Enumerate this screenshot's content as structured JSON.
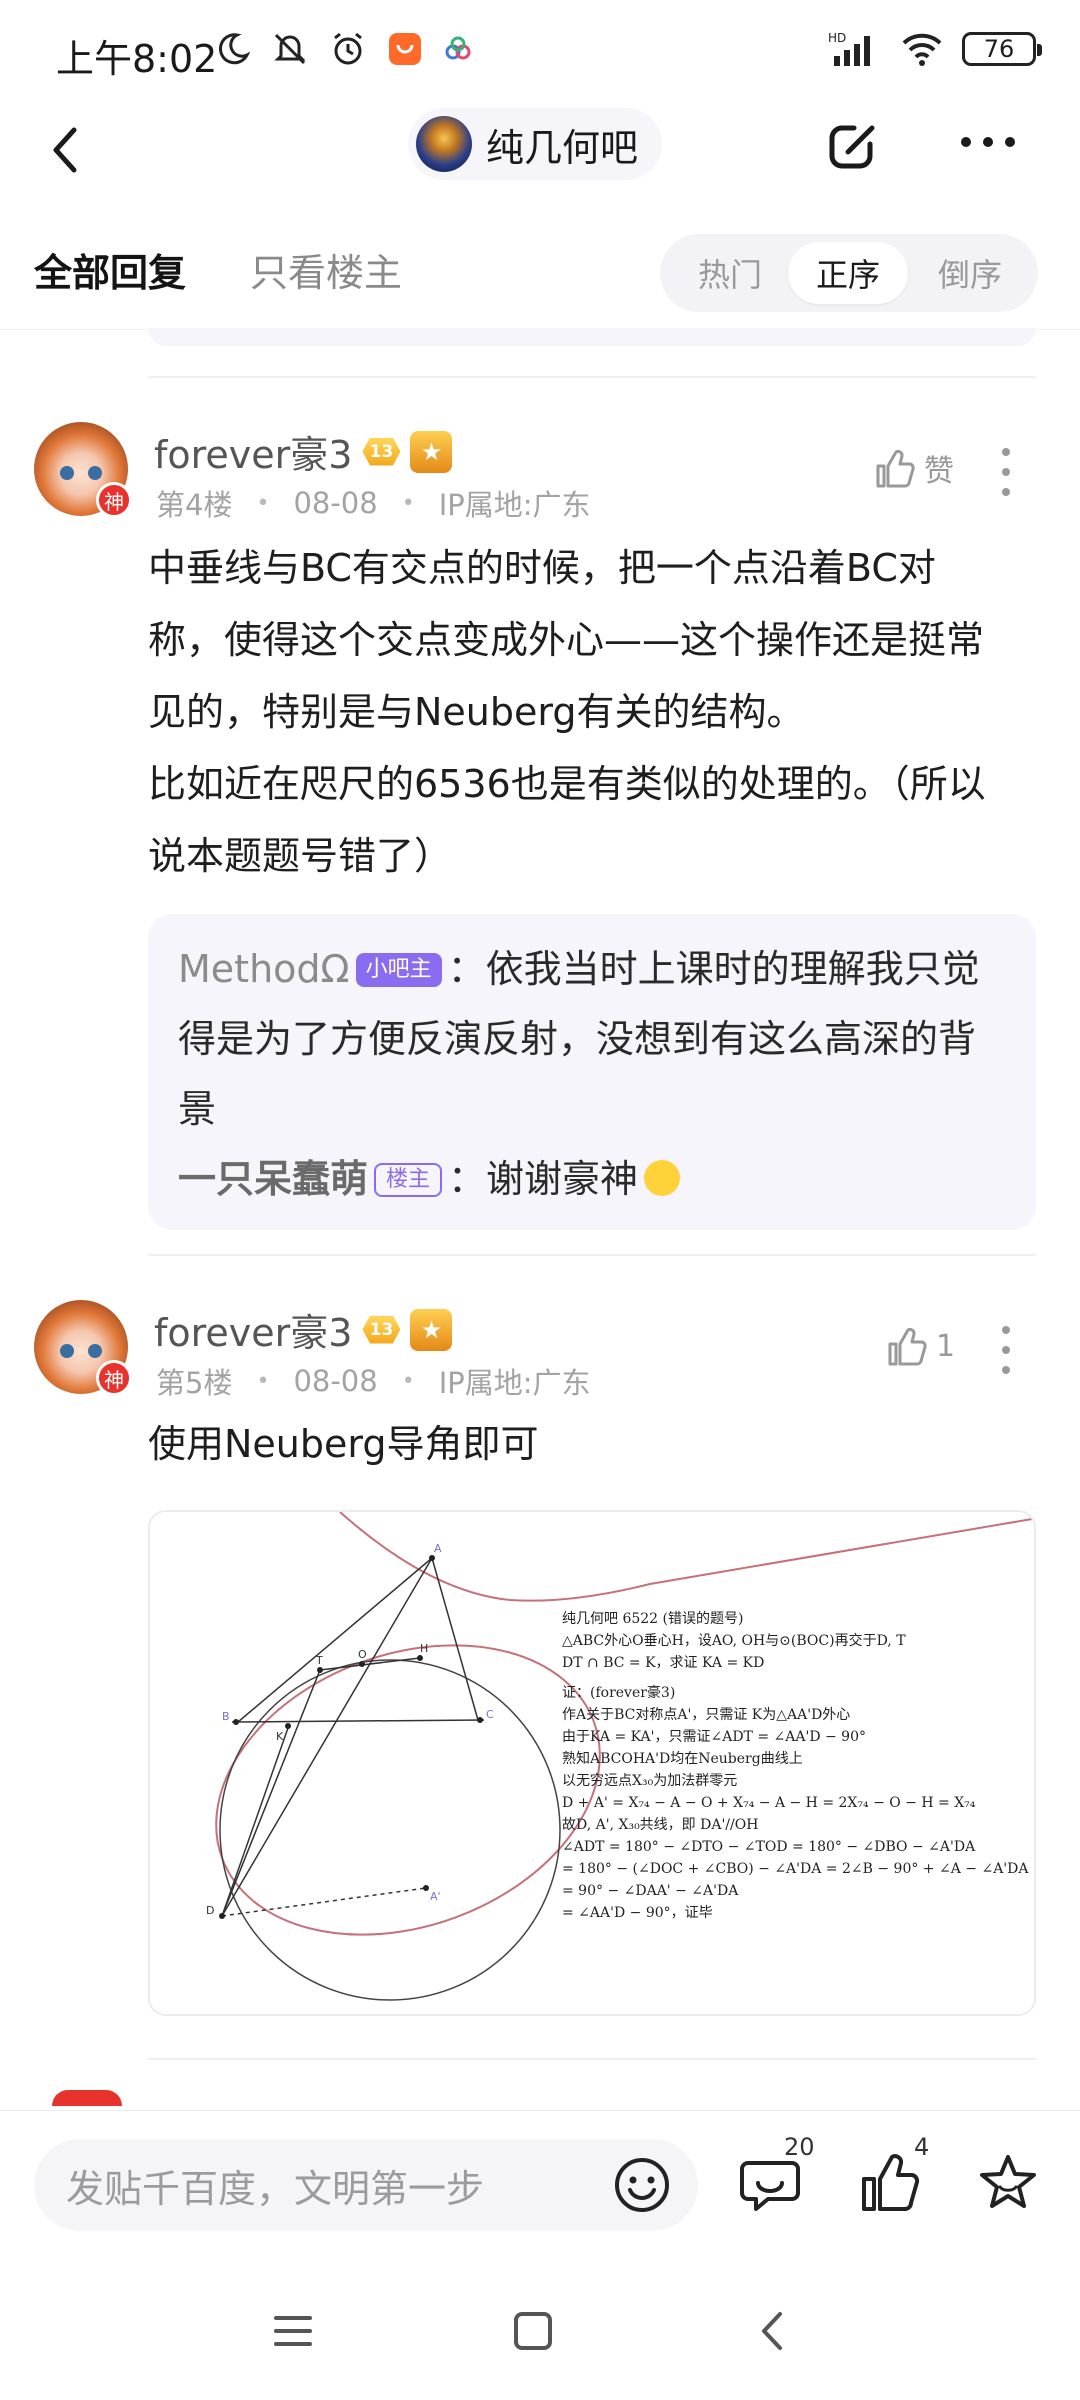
{
  "status_bar": {
    "time": "上午8:02",
    "network": "HD",
    "battery": "76"
  },
  "header": {
    "forum_name": "纯几何吧"
  },
  "tabs": {
    "all_replies": "全部回复",
    "owner_only": "只看楼主",
    "sort_options": [
      "热门",
      "正序",
      "倒序"
    ],
    "active_sort": "正序"
  },
  "posts": [
    {
      "username": "forever豪3",
      "level": "13",
      "god_badge": "神",
      "floor": "第4楼",
      "date": "08-08",
      "ip": "IP属地:广东",
      "like_label": "赞",
      "body": [
        "中垂线与BC有交点的时候，把一个点沿着BC对",
        "称，使得这个交点变成外心——这个操作还是挺常",
        "见的，特别是与Neuberg有关的结构。",
        "比如近在咫尺的6536也是有类似的处理的。（所以",
        "说本题题号错了）"
      ],
      "replies": [
        {
          "user": "MethodΩ",
          "tag": "小吧主",
          "lines": [
            "：依我当时上课时的理解我只觉",
            "得是为了方便反演反射，没想到有这么高深的背",
            "景"
          ]
        },
        {
          "user": "一只呆蠢萌",
          "tag": "楼主",
          "lines": [
            "：谢谢豪神"
          ]
        }
      ]
    },
    {
      "username": "forever豪3",
      "level": "13",
      "god_badge": "神",
      "floor": "第5楼",
      "date": "08-08",
      "ip": "IP属地:广东",
      "like_count": "1",
      "body": [
        "使用Neuberg导角即可"
      ],
      "figure": {
        "point_labels": [
          "A",
          "B",
          "C",
          "D",
          "K",
          "T",
          "O",
          "H",
          "A'"
        ],
        "text_lines": [
          "纯几何吧 6522 (错误的题号)",
          "△ABC外心O垂心H，设AO, OH与⊙(BOC)再交于D, T",
          "DT ∩ BC = K，求证 KA = KD",
          "",
          "证：(forever豪3)",
          "作A关于BC对称点A'，只需证 K为△AA'D外心",
          "由于KA = KA'，只需证∠ADT = ∠AA'D − 90°",
          "熟知ABCOHA'D均在Neuberg曲线上",
          "以无穷远点X₃₀为加法群零元",
          "D + A' = X₇₄ − A − O + X₇₄ − A − H = 2X₇₄ − O − H = X₇₄",
          "故D, A', X₃₀共线，即 DA'//OH",
          "∠ADT = 180° − ∠DTO − ∠TOD = 180° − ∠DBO − ∠A'DA",
          "= 180° − (∠DOC + ∠CBO) − ∠A'DA = 2∠B − 90° + ∠A − ∠A'DA",
          "= 90° − ∠DAA' − ∠A'DA",
          "= ∠AA'D − 90°，证毕"
        ]
      }
    }
  ],
  "bottom_bar": {
    "input_placeholder": "发贴千百度，文明第一步",
    "comment_count": "20",
    "like_count": "4"
  }
}
